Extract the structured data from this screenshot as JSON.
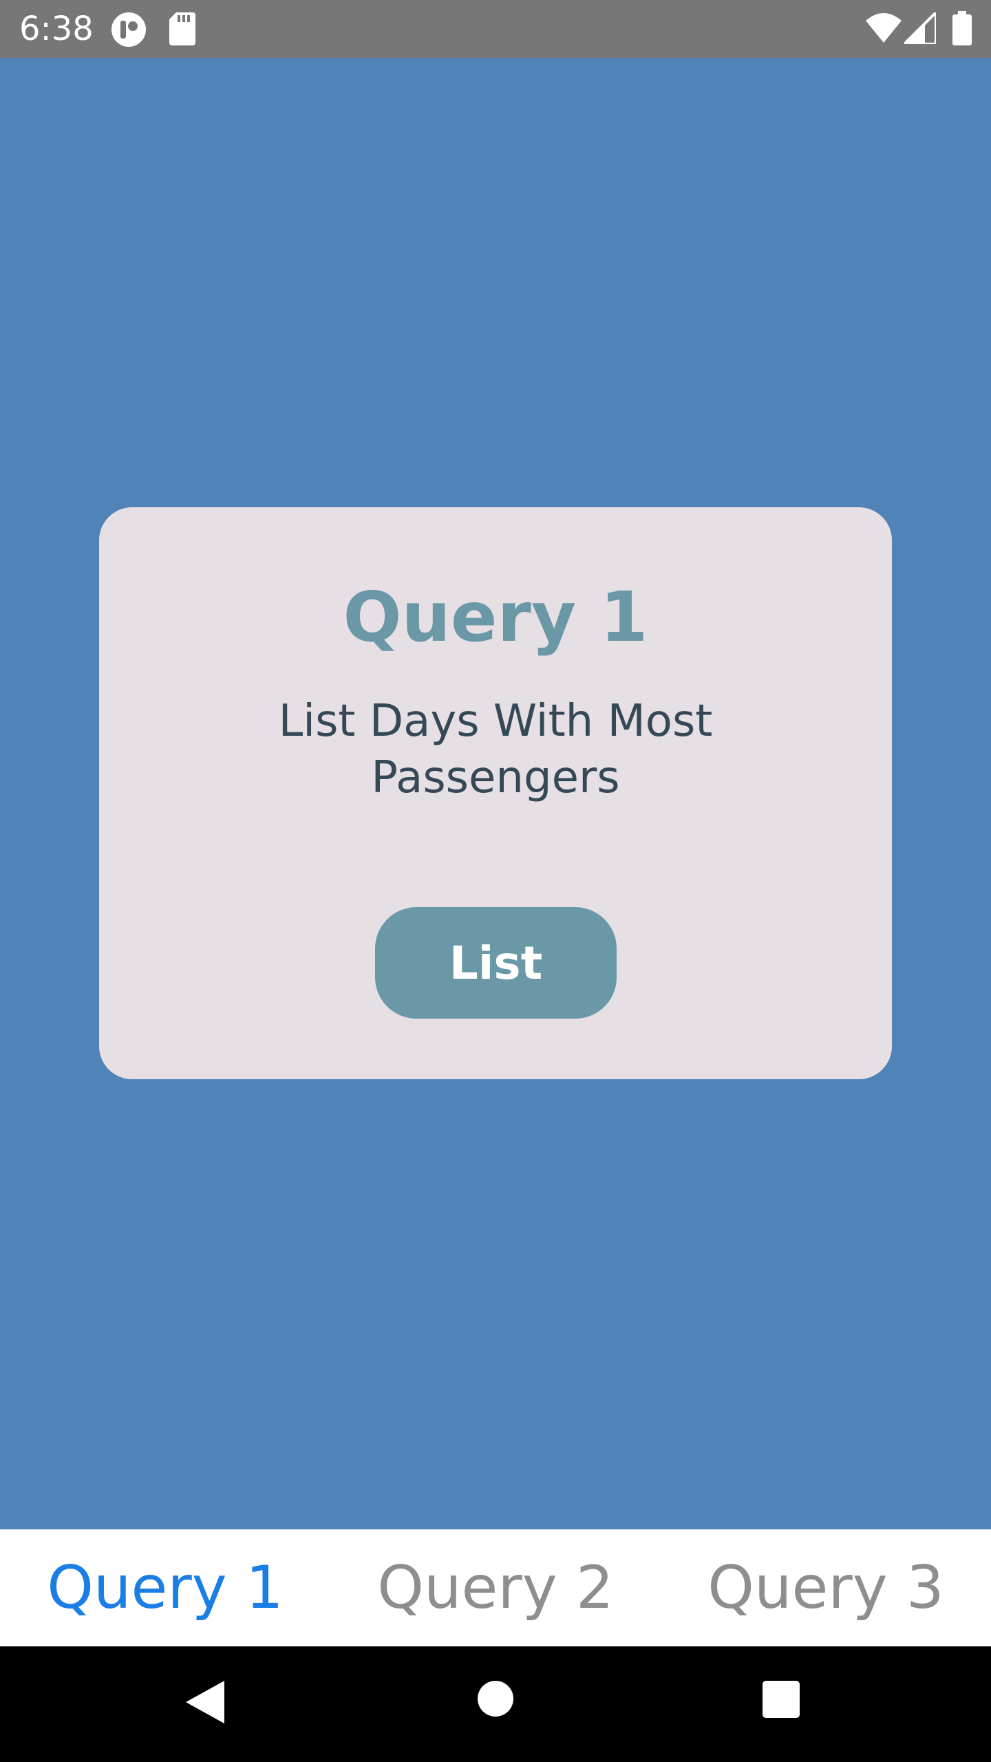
{
  "status_bar": {
    "time": "6:38",
    "icons": [
      "notification-app-icon",
      "sd-card-icon",
      "wifi-icon",
      "cell-signal-icon",
      "battery-icon"
    ]
  },
  "card": {
    "title": "Query 1",
    "description": "List Days With Most Passengers",
    "button_label": "List"
  },
  "tabs": [
    {
      "label": "Query 1",
      "active": true
    },
    {
      "label": "Query 2",
      "active": false
    },
    {
      "label": "Query 3",
      "active": false
    }
  ],
  "nav_bar": {
    "buttons": [
      "back-icon",
      "home-icon",
      "recents-icon"
    ]
  },
  "colors": {
    "background": "#5083b8",
    "card": "#e6e0e5",
    "accent": "#6b98a6",
    "active_tab": "#1a7ee6",
    "inactive_tab": "#8e8e8e",
    "status_bar": "#777777"
  }
}
